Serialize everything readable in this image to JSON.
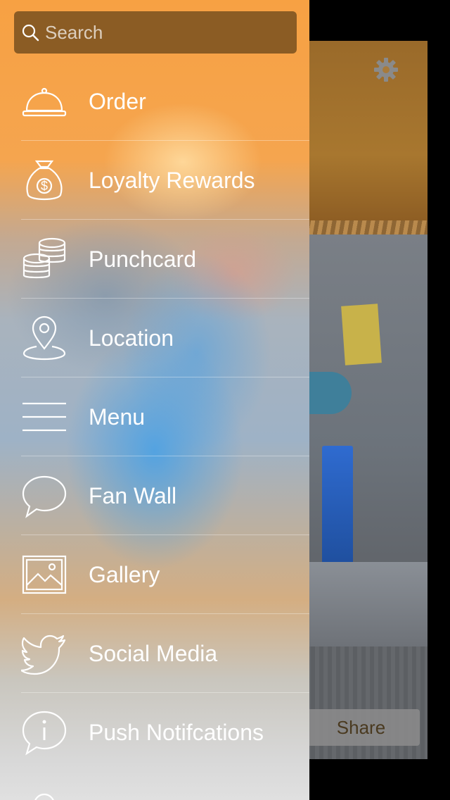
{
  "search": {
    "placeholder": "Search"
  },
  "menu": {
    "items": [
      {
        "label": "Order",
        "icon": "service-bell-icon"
      },
      {
        "label": "Loyalty Rewards",
        "icon": "money-bag-icon"
      },
      {
        "label": "Punchcard",
        "icon": "coins-icon"
      },
      {
        "label": "Location",
        "icon": "map-pin-icon"
      },
      {
        "label": "Menu",
        "icon": "hamburger-lines-icon"
      },
      {
        "label": "Fan Wall",
        "icon": "speech-bubble-icon"
      },
      {
        "label": "Gallery",
        "icon": "image-icon"
      },
      {
        "label": "Social Media",
        "icon": "twitter-bird-icon"
      },
      {
        "label": "Push Notifcations",
        "icon": "info-bubble-icon"
      }
    ]
  },
  "background": {
    "share_label": "Share",
    "settings_icon": "gear-icon"
  },
  "colors": {
    "search_bg": "#7a5020",
    "text": "#ffffff",
    "accent_orange": "#f7a143"
  }
}
